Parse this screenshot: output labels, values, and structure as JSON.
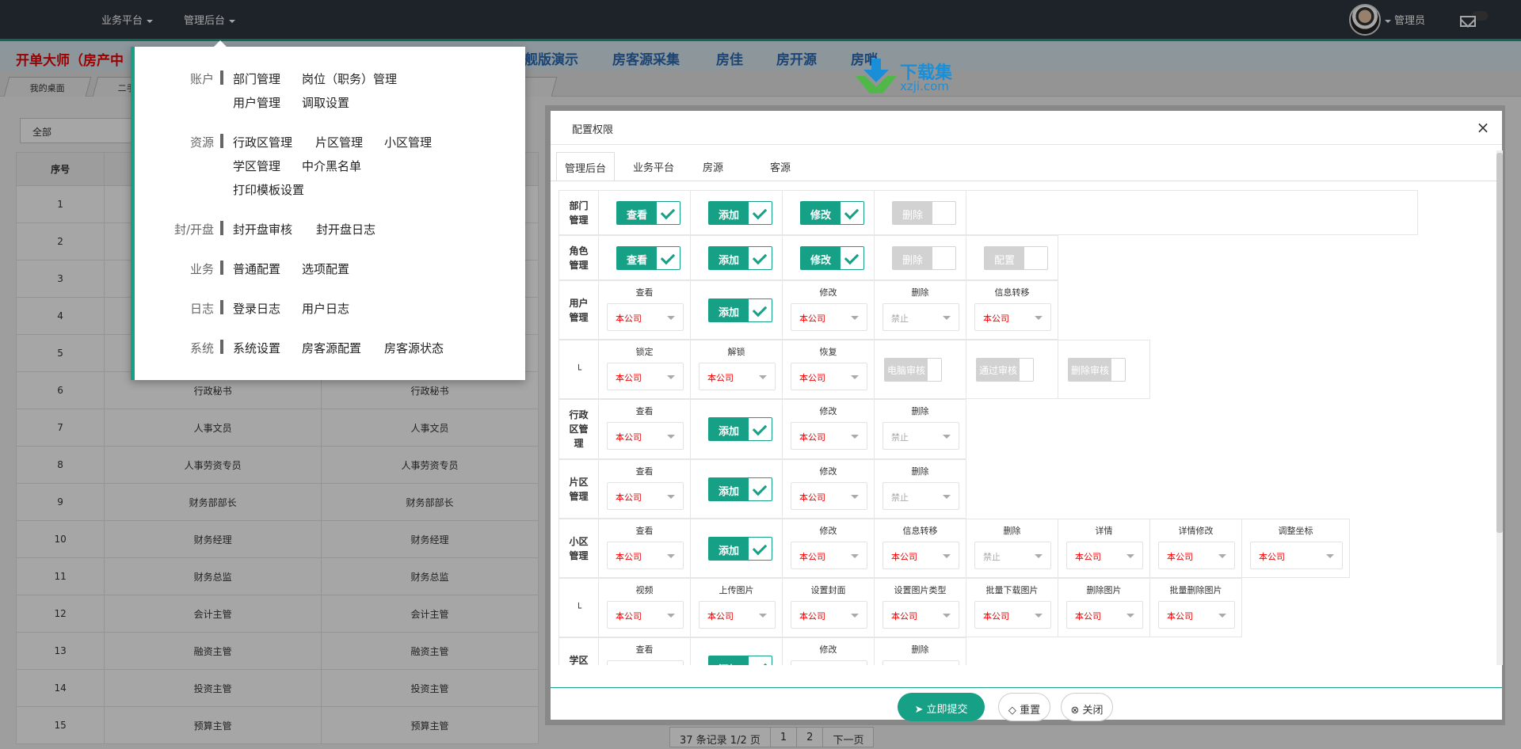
{
  "topbar": {
    "nav": [
      "业务平台",
      "管理后台"
    ],
    "user": "管理员"
  },
  "subbar": {
    "brand": "开单大师（房产中",
    "links": [
      "舰版演示",
      "房客源采集",
      "房佳",
      "房开源",
      "房哨"
    ]
  },
  "watermark": {
    "title": "下载集",
    "domain": "xzji.com"
  },
  "tabs": [
    "我的桌面",
    "二手"
  ],
  "background": {
    "filter": "全部",
    "table_header": [
      "序号",
      "",
      ""
    ],
    "rows": [
      [
        "1",
        "",
        ""
      ],
      [
        "2",
        "",
        ""
      ],
      [
        "3",
        "",
        ""
      ],
      [
        "4",
        "",
        ""
      ],
      [
        "5",
        "",
        ""
      ],
      [
        "6",
        "行政秘书",
        "行政秘书"
      ],
      [
        "7",
        "人事文员",
        "人事文员"
      ],
      [
        "8",
        "人事劳资专员",
        "人事劳资专员"
      ],
      [
        "9",
        "财务部部长",
        "财务部部长"
      ],
      [
        "10",
        "财务经理",
        "财务经理"
      ],
      [
        "11",
        "财务总监",
        "财务总监"
      ],
      [
        "12",
        "会计主管",
        "会计主管"
      ],
      [
        "13",
        "融资主管",
        "融资主管"
      ],
      [
        "14",
        "投资主管",
        "投资主管"
      ],
      [
        "15",
        "预算主管",
        "预算主管"
      ]
    ],
    "pager": [
      "37 条记录 1/2 页",
      "1",
      "2",
      "下一页"
    ]
  },
  "menu": {
    "groups": [
      {
        "label": "账户",
        "links": [
          "部门管理",
          "岗位（职务）管理",
          "用户管理",
          "调取设置"
        ]
      },
      {
        "label": "资源",
        "links": [
          "行政区管理",
          "片区管理",
          "小区管理",
          "学区管理",
          "中介黑名单",
          "打印模板设置"
        ]
      },
      {
        "label": "封/开盘",
        "links": [
          "封开盘审核",
          "封开盘日志"
        ]
      },
      {
        "label": "业务",
        "links": [
          "普通配置",
          "选项配置"
        ]
      },
      {
        "label": "日志",
        "links": [
          "登录日志",
          "用户日志"
        ]
      },
      {
        "label": "系统",
        "links": [
          "系统设置",
          "房客源配置",
          "房客源状态"
        ]
      }
    ]
  },
  "modal": {
    "title": "配置权限",
    "close": "×",
    "tabs": [
      "管理后台",
      "业务平台",
      "房源",
      "客源"
    ],
    "labels": {
      "dept": "部门管理",
      "role": "角色管理",
      "user": "用户管理",
      "sub": "└",
      "district": "行政区管理",
      "area": "片区管理",
      "community": "小区管理",
      "school": "学区管理"
    },
    "toggles": {
      "view": "查看",
      "add": "添加",
      "edit": "修改",
      "delete": "删除",
      "config": "配置",
      "pc_review": "电脑审核",
      "pass_review": "通过审核",
      "delete_review": "删除审核"
    },
    "fields": {
      "view": "查看",
      "edit": "修改",
      "delete": "删除",
      "transfer": "信息转移",
      "lock": "锁定",
      "unlock": "解锁",
      "restore": "恢复",
      "detail": "详情",
      "detail_edit": "详情修改",
      "adjust_coord": "调整坐标",
      "video": "视频",
      "upload_pic": "上传图片",
      "set_cover": "设置封面",
      "set_pic_type": "设置图片类型",
      "batch_download": "批量下载图片",
      "delete_pic": "删除图片",
      "batch_delete_pic": "批量删除图片"
    },
    "values": {
      "company": "本公司",
      "forbid": "禁止"
    },
    "footer": {
      "submit": "立即提交",
      "reset": "重置",
      "close": "关闭"
    }
  },
  "colors": {
    "accent": "#16a085",
    "brand_red": "#e00000",
    "link_blue": "#2a6ab4",
    "navbar": "#2f3640"
  }
}
